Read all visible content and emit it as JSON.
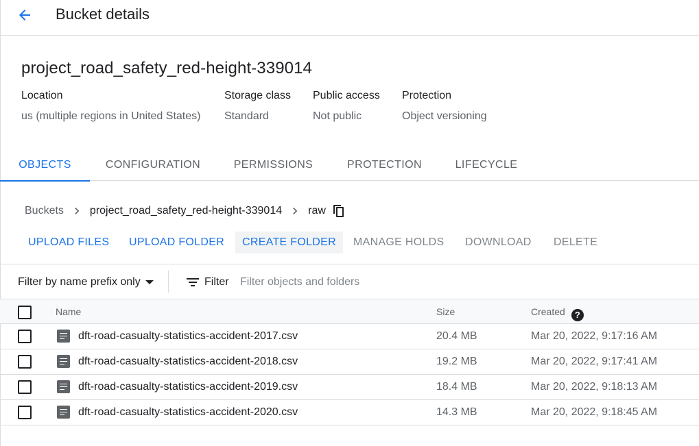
{
  "header": {
    "title": "Bucket details",
    "back_icon": "arrow-back-icon"
  },
  "bucket": {
    "name": "project_road_safety_red-height-339014",
    "info": [
      {
        "label": "Location",
        "value": "us (multiple regions in United States)"
      },
      {
        "label": "Storage class",
        "value": "Standard"
      },
      {
        "label": "Public access",
        "value": "Not public"
      },
      {
        "label": "Protection",
        "value": "Object versioning"
      }
    ]
  },
  "tabs": [
    {
      "label": "OBJECTS",
      "active": true
    },
    {
      "label": "CONFIGURATION",
      "active": false
    },
    {
      "label": "PERMISSIONS",
      "active": false
    },
    {
      "label": "PROTECTION",
      "active": false
    },
    {
      "label": "LIFECYCLE",
      "active": false
    }
  ],
  "breadcrumb": {
    "items": [
      "Buckets",
      "project_road_safety_red-height-339014",
      "raw"
    ],
    "copy_icon": "copy-icon"
  },
  "actions": [
    {
      "label": "UPLOAD FILES",
      "enabled": true
    },
    {
      "label": "UPLOAD FOLDER",
      "enabled": true
    },
    {
      "label": "CREATE FOLDER",
      "enabled": true
    },
    {
      "label": "MANAGE HOLDS",
      "enabled": false
    },
    {
      "label": "DOWNLOAD",
      "enabled": false
    },
    {
      "label": "DELETE",
      "enabled": false
    }
  ],
  "filter": {
    "prefix_label": "Filter by name prefix only",
    "filter_label": "Filter",
    "placeholder": "Filter objects and folders"
  },
  "table": {
    "columns": {
      "name": "Name",
      "size": "Size",
      "created": "Created"
    },
    "help_glyph": "?",
    "rows": [
      {
        "name": "dft-road-casualty-statistics-accident-2017.csv",
        "size": "20.4 MB",
        "created": "Mar 20, 2022, 9:17:16 AM"
      },
      {
        "name": "dft-road-casualty-statistics-accident-2018.csv",
        "size": "19.2 MB",
        "created": "Mar 20, 2022, 9:17:41 AM"
      },
      {
        "name": "dft-road-casualty-statistics-accident-2019.csv",
        "size": "18.4 MB",
        "created": "Mar 20, 2022, 9:18:13 AM"
      },
      {
        "name": "dft-road-casualty-statistics-accident-2020.csv",
        "size": "14.3 MB",
        "created": "Mar 20, 2022, 9:18:45 AM"
      }
    ]
  },
  "colors": {
    "accent": "#1a73e8",
    "text": "#202124",
    "muted": "#5f6368",
    "disabled": "#80868b",
    "divider": "#dadce0"
  }
}
